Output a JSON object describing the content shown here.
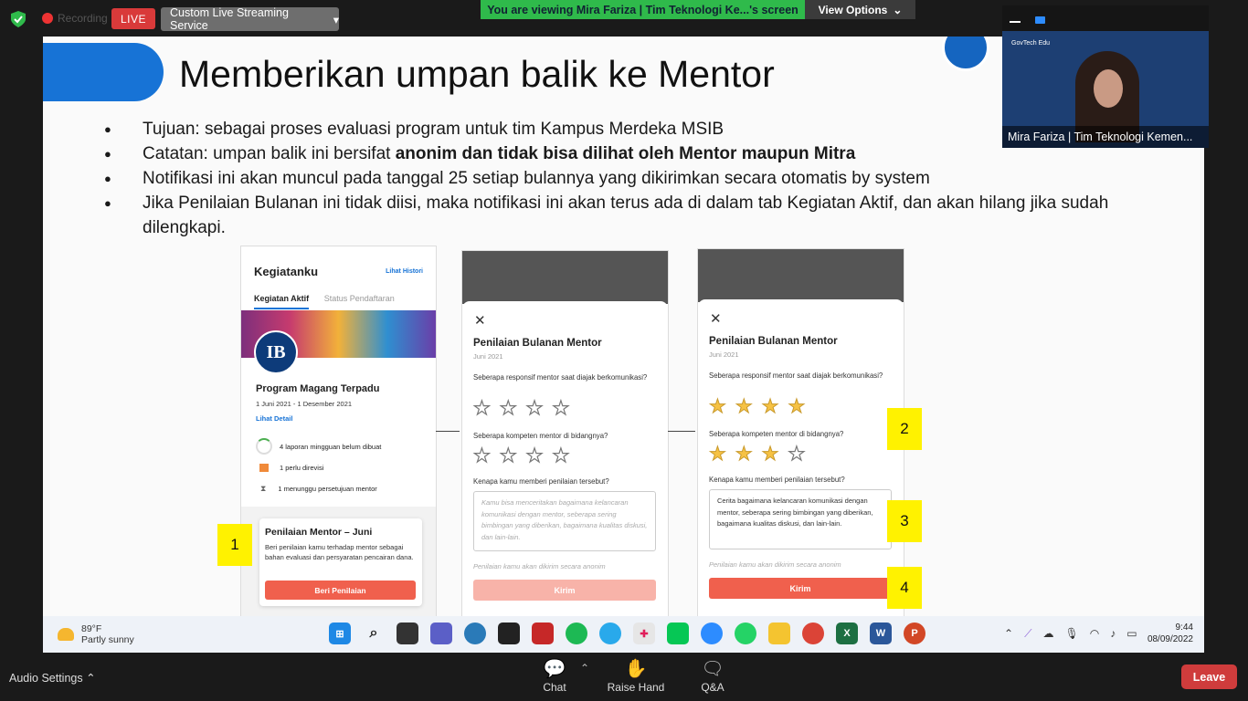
{
  "zoom_top": {
    "recording_label": "Recording",
    "live_label": "LIVE",
    "stream_label": "Custom Live Streaming Service",
    "viewing_label": "You are viewing Mira Fariza | Tim Teknologi Ke...'s screen",
    "view_options_label": "View Options"
  },
  "slide": {
    "title": "Memberikan umpan balik ke Mentor",
    "bullets": [
      {
        "text": "Tujuan: sebagai proses evaluasi program untuk tim Kampus Merdeka MSIB"
      },
      {
        "prefix": "Catatan: umpan balik ini bersifat ",
        "bold": "anonim dan tidak bisa dilihat oleh Mentor maupun Mitra"
      },
      {
        "text": "Notifikasi ini akan muncul pada tanggal 25 setiap bulannya yang dikirimkan secara otomatis by system"
      },
      {
        "text": "Jika Penilaian Bulanan ini tidak diisi, maka notifikasi ini akan terus ada di dalam tab Kegiatan Aktif, dan akan hilang jika sudah dilengkapi."
      }
    ],
    "phone1": {
      "title": "Kegiatanku",
      "history_link": "Lihat Histori",
      "tab_active": "Kegiatan Aktif",
      "tab_inactive": "Status Pendaftaran",
      "logo_text": "IB",
      "program_title": "Program Magang Terpadu",
      "program_date": "1 Juni 2021 - 1 Desember 2021",
      "detail_link": "Lihat Detail",
      "items": [
        "4 laporan mingguan belum dibuat",
        "1 perlu direvisi",
        "1 menunggu persetujuan mentor"
      ],
      "card_title": "Penilaian Mentor – Juni",
      "card_desc": "Beri penilaian kamu terhadap mentor sebagai bahan evaluasi dan persyaratan pencairan dana.",
      "card_button": "Beri Penilaian"
    },
    "rating": {
      "title": "Penilaian Bulanan Mentor",
      "date": "Juni 2021",
      "q1": "Seberapa responsif mentor saat diajak berkomunikasi?",
      "q2": "Seberapa kompeten mentor di bidangnya?",
      "q3": "Kenapa kamu memberi penilaian tersebut?",
      "placeholder": "Kamu bisa menceritakan bagaimana kelancaran komunikasi dengan mentor, seberapa sering bimbingan yang diberikan, bagaimana kualitas diskusi, dan lain-lain.",
      "filled_text": "Cerita bagaimana kelancaran komunikasi dengan mentor, seberapa sering bimbingan yang diberikan, bagaimana kualitas diskusi, dan lain-lain.",
      "anon_note": "Penilaian kamu akan dikirim secara anonim",
      "send_label": "Kirim",
      "close_glyph": "✕",
      "star_glyph": "★",
      "filled_stars_q1": 4,
      "filled_stars_q2": 3
    },
    "badges": [
      "1",
      "2",
      "3",
      "4"
    ]
  },
  "video": {
    "brand": "GovTech Edu",
    "name": "Mira Fariza | Tim Teknologi Kemen..."
  },
  "taskbar": {
    "temp": "89°F",
    "weather": "Partly sunny",
    "time": "9:44",
    "date": "08/09/2022"
  },
  "zoom_bottom": {
    "audio_settings": "Audio Settings",
    "chat": "Chat",
    "raise_hand": "Raise Hand",
    "qa": "Q&A",
    "leave": "Leave"
  }
}
